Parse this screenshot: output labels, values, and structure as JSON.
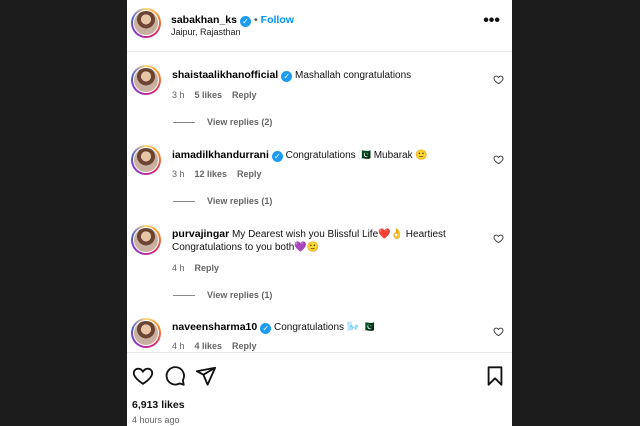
{
  "post": {
    "username": "sabakhan_ks",
    "follow_label": "Follow",
    "separator": "•",
    "location": "Jaipur, Rajasthan",
    "more_label": "•••"
  },
  "comments": [
    {
      "username": "shaistaalikhanofficial",
      "text": "Mashallah congratulations",
      "time": "3 h",
      "likes": "5 likes",
      "reply_label": "Reply",
      "view_replies": "View replies (2)"
    },
    {
      "username": "iamadilkhandurrani",
      "text": "Congratulations 🇵🇰 Mubarak 🙂",
      "time": "3 h",
      "likes": "12 likes",
      "reply_label": "Reply",
      "view_replies": "View replies (1)"
    },
    {
      "username": "purvajingar",
      "text": "My Dearest wish you Blissful Life❤️👌 Heartiest Congratulations to you both💜🙂",
      "time": "4 h",
      "likes": "",
      "reply_label": "Reply",
      "view_replies": "View replies (1)"
    },
    {
      "username": "naveensharma10",
      "text": "Congratulations 🌬️ 🇵🇰",
      "time": "4 h",
      "likes": "4 likes",
      "reply_label": "Reply",
      "view_replies": ""
    }
  ],
  "footer": {
    "likes_count": "6,913 likes",
    "posted_time": "4 hours ago"
  },
  "icons": {
    "verified": "verified-badge-icon",
    "like": "heart-icon",
    "comment": "comment-icon",
    "share": "send-icon",
    "save": "bookmark-icon",
    "more": "more-options-icon"
  },
  "colors": {
    "link": "#0095f6",
    "verified": "#1d9bf0"
  }
}
